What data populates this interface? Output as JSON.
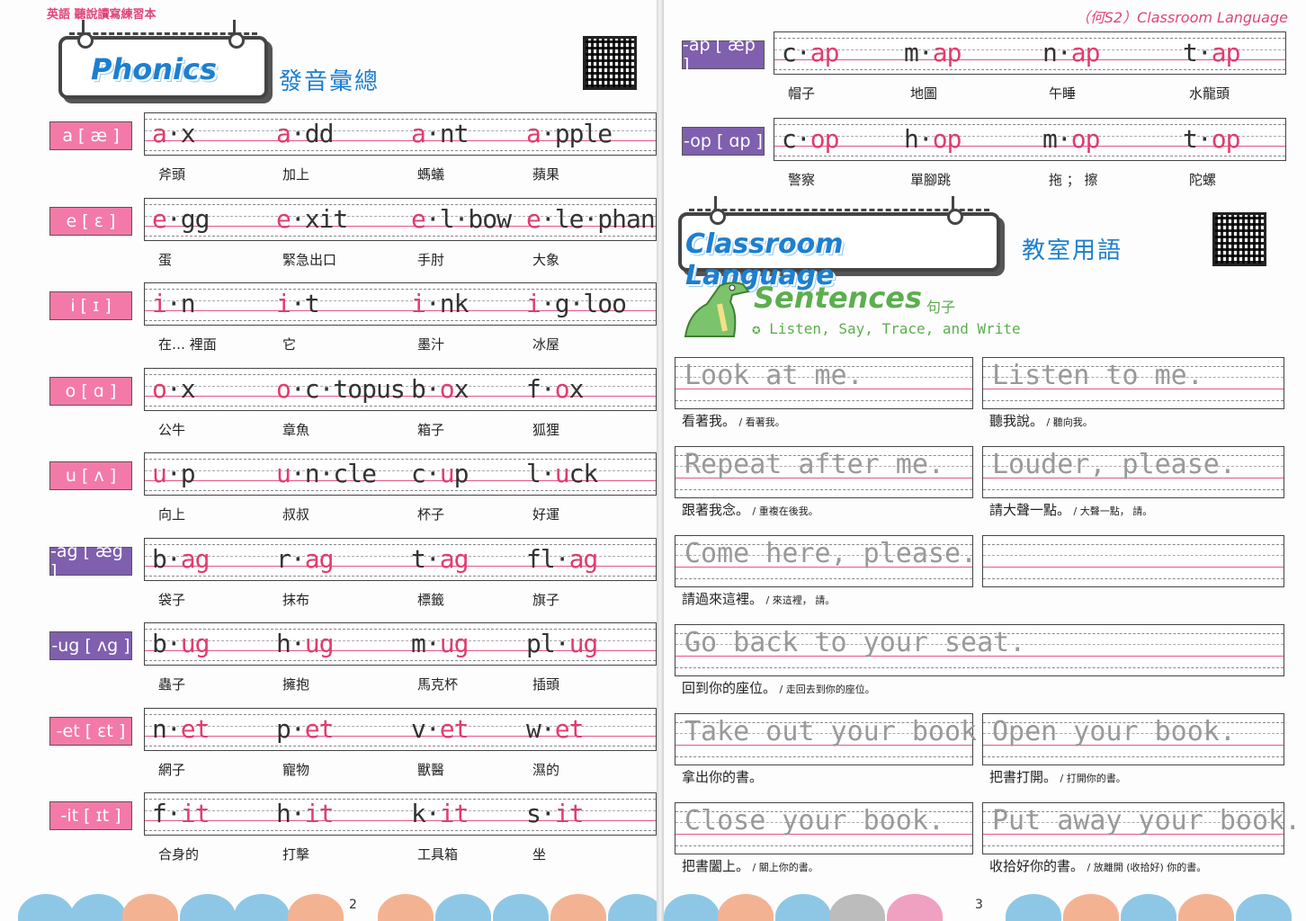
{
  "left_page": {
    "header": "英語 聽說讀寫練習本",
    "title_en": "Phonics",
    "title_zh": "發音彙總",
    "page_number": "2",
    "rows": [
      {
        "tag": "a [ æ ]",
        "color": "pink",
        "words": [
          {
            "pre": "",
            "red": "a",
            "post": "·x"
          },
          {
            "pre": "",
            "red": "a",
            "post": "·dd"
          },
          {
            "pre": "",
            "red": "a",
            "post": "·nt"
          },
          {
            "pre": "",
            "red": "a",
            "post": "·pple"
          }
        ],
        "zh": [
          "斧頭",
          "加上",
          "螞蟻",
          "蘋果"
        ]
      },
      {
        "tag": "e [ ɛ ]",
        "color": "pink",
        "words": [
          {
            "pre": "",
            "red": "e",
            "post": "·gg"
          },
          {
            "pre": "",
            "red": "e",
            "post": "·xit"
          },
          {
            "pre": "",
            "red": "e",
            "post": "·l·bow"
          },
          {
            "pre": "",
            "red": "e",
            "post": "·le·phant"
          }
        ],
        "zh": [
          "蛋",
          "緊急出口",
          "手肘",
          "大象"
        ]
      },
      {
        "tag": "i [ ɪ ]",
        "color": "pink",
        "words": [
          {
            "pre": "",
            "red": "i",
            "post": "·n"
          },
          {
            "pre": "",
            "red": "i",
            "post": "·t"
          },
          {
            "pre": "",
            "red": "i",
            "post": "·nk"
          },
          {
            "pre": "",
            "red": "i",
            "post": "·g·loo"
          }
        ],
        "zh": [
          "在… 裡面",
          "它",
          "墨汁",
          "冰屋"
        ]
      },
      {
        "tag": "o [ ɑ ]",
        "color": "pink",
        "words": [
          {
            "pre": "",
            "red": "o",
            "post": "·x"
          },
          {
            "pre": "",
            "red": "o",
            "post": "·c·topus"
          },
          {
            "pre": "b·",
            "red": "o",
            "post": "x"
          },
          {
            "pre": "f·",
            "red": "o",
            "post": "x"
          }
        ],
        "zh": [
          "公牛",
          "章魚",
          "箱子",
          "狐狸"
        ]
      },
      {
        "tag": "u [ ʌ ]",
        "color": "pink",
        "words": [
          {
            "pre": "",
            "red": "u",
            "post": "·p"
          },
          {
            "pre": "",
            "red": "u",
            "post": "·n·cle"
          },
          {
            "pre": "c·",
            "red": "u",
            "post": "p"
          },
          {
            "pre": "l·",
            "red": "u",
            "post": "ck"
          }
        ],
        "zh": [
          "向上",
          "叔叔",
          "杯子",
          "好運"
        ]
      },
      {
        "tag": "-ag [ æg ]",
        "color": "purple",
        "words": [
          {
            "pre": "b·",
            "red": "ag",
            "post": ""
          },
          {
            "pre": "r·",
            "red": "ag",
            "post": ""
          },
          {
            "pre": "t·",
            "red": "ag",
            "post": ""
          },
          {
            "pre": "fl·",
            "red": "ag",
            "post": ""
          }
        ],
        "zh": [
          "袋子",
          "抹布",
          "標籤",
          "旗子"
        ]
      },
      {
        "tag": "-ug [ ʌg ]",
        "color": "purple",
        "words": [
          {
            "pre": "b·",
            "red": "ug",
            "post": ""
          },
          {
            "pre": "h·",
            "red": "ug",
            "post": ""
          },
          {
            "pre": "m·",
            "red": "ug",
            "post": ""
          },
          {
            "pre": "pl·",
            "red": "ug",
            "post": ""
          }
        ],
        "zh": [
          "蟲子",
          "擁抱",
          "馬克杯",
          "插頭"
        ]
      },
      {
        "tag": "-et [ ɛt ]",
        "color": "pink",
        "words": [
          {
            "pre": "n·",
            "red": "et",
            "post": ""
          },
          {
            "pre": "p·",
            "red": "et",
            "post": ""
          },
          {
            "pre": "v·",
            "red": "et",
            "post": ""
          },
          {
            "pre": "w·",
            "red": "et",
            "post": ""
          }
        ],
        "zh": [
          "網子",
          "寵物",
          "獸醫",
          "濕的"
        ]
      },
      {
        "tag": "-it [ ɪt ]",
        "color": "pink",
        "words": [
          {
            "pre": "f·",
            "red": "it",
            "post": ""
          },
          {
            "pre": "h·",
            "red": "it",
            "post": ""
          },
          {
            "pre": "k·",
            "red": "it",
            "post": ""
          },
          {
            "pre": "s·",
            "red": "it",
            "post": ""
          }
        ],
        "zh": [
          "合身的",
          "打擊",
          "工具箱",
          "坐"
        ]
      }
    ]
  },
  "right_page": {
    "header": "（何S2）Classroom Language",
    "page_number": "3",
    "rows": [
      {
        "tag": "-ap [ æp ]",
        "color": "purple",
        "words": [
          {
            "pre": "c·",
            "red": "ap",
            "post": ""
          },
          {
            "pre": "m·",
            "red": "ap",
            "post": ""
          },
          {
            "pre": "n·",
            "red": "ap",
            "post": ""
          },
          {
            "pre": "t·",
            "red": "ap",
            "post": ""
          }
        ],
        "zh": [
          "帽子",
          "地圖",
          "午睡",
          "水龍頭"
        ]
      },
      {
        "tag": "-op [ ɑp ]",
        "color": "purple",
        "words": [
          {
            "pre": "c·",
            "red": "op",
            "post": ""
          },
          {
            "pre": "h·",
            "red": "op",
            "post": ""
          },
          {
            "pre": "m·",
            "red": "op",
            "post": ""
          },
          {
            "pre": "t·",
            "red": "op",
            "post": ""
          }
        ],
        "zh": [
          "警察",
          "單腳跳",
          "拖 ； 擦",
          "陀螺"
        ]
      }
    ],
    "title_en": "Classroom Language",
    "title_zh": "教室用語",
    "sentences_title": "Sentences",
    "sentences_zh": "句子",
    "instruction": "Listen, Say, Trace, and Write",
    "sentences": [
      {
        "en": "Look at me.",
        "zh": "看著我。",
        "zh_small": "/ 看著我。"
      },
      {
        "en": "Listen to me.",
        "zh": "聽我說。",
        "zh_small": "/ 聽向我。"
      },
      {
        "en": "Repeat after me.",
        "zh": "跟著我念。",
        "zh_small": "/ 重複在後我。"
      },
      {
        "en": "Louder, please.",
        "zh": "請大聲一點。",
        "zh_small": "/ 大聲一點， 請。"
      },
      {
        "en": "Come here, please.",
        "zh": "請過來這裡。",
        "zh_small": "/ 來這裡， 請。"
      },
      {
        "en": "",
        "zh": "",
        "zh_small": ""
      },
      {
        "en": "Go back to your seat.",
        "zh": "回到你的座位。",
        "zh_small": "/ 走回去到你的座位。"
      },
      {
        "en": "Take out your book.",
        "zh": "拿出你的書。",
        "zh_small": ""
      },
      {
        "en": "Open your book.",
        "zh": "把書打開。",
        "zh_small": "/ 打開你的書。"
      },
      {
        "en": "Close your book.",
        "zh": "把書闔上。",
        "zh_small": "/ 關上你的書。"
      },
      {
        "en": "Put away your book.",
        "zh": "收拾好你的書。",
        "zh_small": "/ 放離開 (收拾好) 你的書。"
      }
    ]
  },
  "colors": {
    "pink_tag": "#f37aa8",
    "purple_tag": "#7f5fae",
    "title_blue": "#1d7fcf",
    "guide_red": "#e3568a",
    "sentence_green": "#5cae4e"
  }
}
